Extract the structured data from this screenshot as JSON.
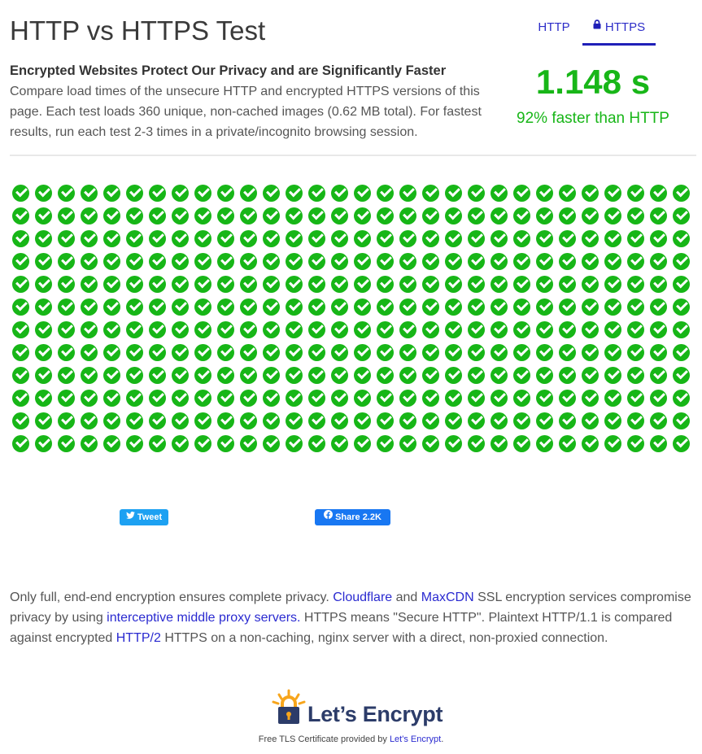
{
  "page": {
    "title": "HTTP vs HTTPS Test"
  },
  "nav": {
    "http_label": "HTTP",
    "https_label": "HTTPS",
    "active": "HTTPS"
  },
  "intro": {
    "heading": "Encrypted Websites Protect Our Privacy and are Significantly Faster",
    "body": "Compare load times of the unsecure HTTP and encrypted HTTPS versions of this page. Each test loads 360 unique, non-cached images (0.62 MB total). For fastest results, run each test 2-3 times in a private/incognito browsing session."
  },
  "result": {
    "time": "1.148 s",
    "comparison": "92% faster than HTTP"
  },
  "image_grid": {
    "rows": 12,
    "columns": 30,
    "loaded_count": 360,
    "icon": "green-check-icon",
    "color": "#17b617"
  },
  "share": {
    "tweet_label": "Tweet",
    "facebook_label": "Share 2.2K"
  },
  "privacy_note": {
    "t1": "Only full, end-end encryption ensures complete privacy. ",
    "link_cloudflare": "Cloudflare",
    "t2": " and ",
    "link_maxcdn": "MaxCDN",
    "t3": " SSL encryption services compromise privacy by using ",
    "link_proxy": "interceptive middle proxy servers.",
    "t4": " HTTPS means \"Secure HTTP\". Plaintext HTTP/1.1 is compared against encrypted ",
    "link_http2": "HTTP/2",
    "t5": " HTTPS on a non-caching, nginx server with a direct, non-proxied connection."
  },
  "footer": {
    "logo_text": "Let’s Encrypt",
    "caption": "Free TLS Certificate provided by ",
    "link": "Let's Encrypt",
    "caption_end": "."
  },
  "colors": {
    "accent_green": "#18b618",
    "link_blue": "#2a2ad0",
    "tweet_blue": "#1da1f2",
    "facebook_blue": "#1877f2",
    "le_navy": "#2c3c69",
    "le_orange": "#f7a51b"
  }
}
